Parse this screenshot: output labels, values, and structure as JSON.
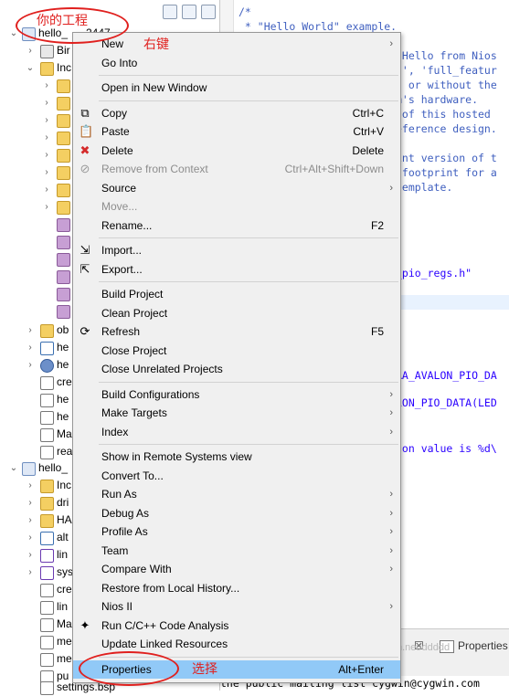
{
  "explorer": {
    "items": [
      {
        "label": "hello_",
        "suffix": "2447",
        "icon": "project-icon"
      },
      {
        "label": "Bir",
        "icon": "binaries-icon"
      },
      {
        "label": "Inc",
        "icon": "includes-folder-icon"
      },
      {
        "label": "",
        "icon": "include-path-icon"
      },
      {
        "label": "",
        "icon": "include-path-icon"
      },
      {
        "label": "",
        "icon": "include-path-icon"
      },
      {
        "label": "",
        "icon": "include-path-icon"
      },
      {
        "label": "",
        "icon": "include-path-icon"
      },
      {
        "label": "",
        "icon": "include-path-icon"
      },
      {
        "label": "",
        "icon": "include-path-icon"
      },
      {
        "label": "",
        "icon": "include-path-icon"
      },
      {
        "label": "",
        "icon": "package-icon"
      },
      {
        "label": "",
        "icon": "package-icon"
      },
      {
        "label": "",
        "icon": "package-icon"
      },
      {
        "label": "",
        "icon": "package-icon"
      },
      {
        "label": "",
        "icon": "package-icon"
      },
      {
        "label": "",
        "icon": "package-icon"
      },
      {
        "label": "ob",
        "icon": "folder-icon"
      },
      {
        "label": "he",
        "icon": "c-file-icon"
      },
      {
        "label": "he",
        "icon": "executable-icon"
      },
      {
        "label": "cre",
        "icon": "file-icon"
      },
      {
        "label": "he",
        "icon": "file-icon"
      },
      {
        "label": "he",
        "icon": "file-icon"
      },
      {
        "label": "Ma",
        "icon": "makefile-icon"
      },
      {
        "label": "rea",
        "icon": "file-icon"
      },
      {
        "label": "hello_",
        "icon": "project-icon"
      },
      {
        "label": "Inc",
        "icon": "includes-folder-icon"
      },
      {
        "label": "dri",
        "icon": "folder-icon"
      },
      {
        "label": "HA",
        "icon": "folder-icon"
      },
      {
        "label": "alt",
        "icon": "c-file-icon"
      },
      {
        "label": "lin",
        "icon": "h-file-icon"
      },
      {
        "label": "sys",
        "icon": "h-file-icon"
      },
      {
        "label": "cre",
        "icon": "file-icon"
      },
      {
        "label": "lin",
        "icon": "file-icon"
      },
      {
        "label": "Ma",
        "icon": "makefile-icon"
      },
      {
        "label": "me",
        "icon": "file-icon"
      },
      {
        "label": "me",
        "icon": "file-icon"
      },
      {
        "label": "pu",
        "icon": "file-icon"
      },
      {
        "label": "settings.bsp",
        "icon": "file-icon"
      }
    ]
  },
  "editor": {
    "lines": [
      {
        "text": "/*",
        "kind": "comment"
      },
      {
        "text": " * \"Hello World\" example.",
        "kind": "comment"
      },
      {
        "text": "",
        "kind": "comment"
      },
      {
        "text": "'Hello from Nios",
        "kind": "comment"
      },
      {
        "text": "d', 'full_featur",
        "kind": "comment"
      },
      {
        "text": "h or without the",
        "kind": "comment"
      },
      {
        "text": "m's hardware.",
        "kind": "comment"
      },
      {
        "text": " of this hosted",
        "kind": "comment"
      },
      {
        "text": "eference design.",
        "kind": "comment"
      },
      {
        "text": "",
        "kind": "comment"
      },
      {
        "text": "int version of t",
        "kind": "comment"
      },
      {
        "text": " footprint for a",
        "kind": "comment"
      },
      {
        "text": "template.",
        "kind": "comment"
      },
      {
        "text": "_pio_regs.h\"",
        "kind": "code"
      },
      {
        "text": ";",
        "kind": "code"
      },
      {
        "text": "RA_AVALON_PIO_DA",
        "kind": "code"
      },
      {
        "text": "LON_PIO_DATA(LED",
        "kind": "code"
      },
      {
        "text": "ton value is %d\\",
        "kind": "code"
      }
    ]
  },
  "bottom_tabs": {
    "console_close": "☒",
    "properties_label": "Properties"
  },
  "console_text": "the public mailing list cygwin@cygwin.com",
  "watermark": "https://blog.csdn.net/ddddd",
  "context_menu": {
    "items": [
      {
        "label": "New",
        "key": "",
        "submenu": true,
        "icon": "",
        "disabled": false
      },
      {
        "label": "Go Into",
        "key": "",
        "submenu": false,
        "icon": "",
        "disabled": false
      },
      {
        "sep": true
      },
      {
        "label": "Open in New Window",
        "key": "",
        "submenu": false,
        "icon": "",
        "disabled": false
      },
      {
        "sep": true
      },
      {
        "label": "Copy",
        "key": "Ctrl+C",
        "submenu": false,
        "icon": "copy-icon",
        "disabled": false
      },
      {
        "label": "Paste",
        "key": "Ctrl+V",
        "submenu": false,
        "icon": "paste-icon",
        "disabled": false
      },
      {
        "label": "Delete",
        "key": "Delete",
        "submenu": false,
        "icon": "delete-icon",
        "disabled": false
      },
      {
        "label": "Remove from Context",
        "key": "Ctrl+Alt+Shift+Down",
        "submenu": false,
        "icon": "remove-context-icon",
        "disabled": true
      },
      {
        "label": "Source",
        "key": "",
        "submenu": true,
        "icon": "",
        "disabled": false
      },
      {
        "label": "Move...",
        "key": "",
        "submenu": false,
        "icon": "",
        "disabled": true
      },
      {
        "label": "Rename...",
        "key": "F2",
        "submenu": false,
        "icon": "",
        "disabled": false
      },
      {
        "sep": true
      },
      {
        "label": "Import...",
        "key": "",
        "submenu": false,
        "icon": "import-icon",
        "disabled": false
      },
      {
        "label": "Export...",
        "key": "",
        "submenu": false,
        "icon": "export-icon",
        "disabled": false
      },
      {
        "sep": true
      },
      {
        "label": "Build Project",
        "key": "",
        "submenu": false,
        "icon": "",
        "disabled": false
      },
      {
        "label": "Clean Project",
        "key": "",
        "submenu": false,
        "icon": "",
        "disabled": false
      },
      {
        "label": "Refresh",
        "key": "F5",
        "submenu": false,
        "icon": "refresh-icon",
        "disabled": false
      },
      {
        "label": "Close Project",
        "key": "",
        "submenu": false,
        "icon": "",
        "disabled": false
      },
      {
        "label": "Close Unrelated Projects",
        "key": "",
        "submenu": false,
        "icon": "",
        "disabled": false
      },
      {
        "sep": true
      },
      {
        "label": "Build Configurations",
        "key": "",
        "submenu": true,
        "icon": "",
        "disabled": false
      },
      {
        "label": "Make Targets",
        "key": "",
        "submenu": true,
        "icon": "",
        "disabled": false
      },
      {
        "label": "Index",
        "key": "",
        "submenu": true,
        "icon": "",
        "disabled": false
      },
      {
        "sep": true
      },
      {
        "label": "Show in Remote Systems view",
        "key": "",
        "submenu": false,
        "icon": "",
        "disabled": false
      },
      {
        "label": "Convert To...",
        "key": "",
        "submenu": false,
        "icon": "",
        "disabled": false
      },
      {
        "label": "Run As",
        "key": "",
        "submenu": true,
        "icon": "",
        "disabled": false
      },
      {
        "label": "Debug As",
        "key": "",
        "submenu": true,
        "icon": "",
        "disabled": false
      },
      {
        "label": "Profile As",
        "key": "",
        "submenu": true,
        "icon": "",
        "disabled": false
      },
      {
        "label": "Team",
        "key": "",
        "submenu": true,
        "icon": "",
        "disabled": false
      },
      {
        "label": "Compare With",
        "key": "",
        "submenu": true,
        "icon": "",
        "disabled": false
      },
      {
        "label": "Restore from Local History...",
        "key": "",
        "submenu": false,
        "icon": "",
        "disabled": false
      },
      {
        "label": "Nios II",
        "key": "",
        "submenu": true,
        "icon": "",
        "disabled": false
      },
      {
        "label": "Run C/C++ Code Analysis",
        "key": "",
        "submenu": false,
        "icon": "code-analysis-icon",
        "disabled": false
      },
      {
        "label": "Update Linked Resources",
        "key": "",
        "submenu": false,
        "icon": "",
        "disabled": false
      },
      {
        "sep": true
      },
      {
        "label": "Properties",
        "key": "Alt+Enter",
        "submenu": false,
        "icon": "",
        "disabled": false,
        "hover": true
      }
    ]
  },
  "annotations": {
    "project_note": "你的工程",
    "right_click_note": "右键",
    "select_note": "选择"
  },
  "colors": {
    "annotation": "#e0201e",
    "menu_hover": "#91c9f7",
    "menu_bg": "#f0f0f0",
    "comment": "#3f5fbf",
    "string": "#2a00ff"
  }
}
